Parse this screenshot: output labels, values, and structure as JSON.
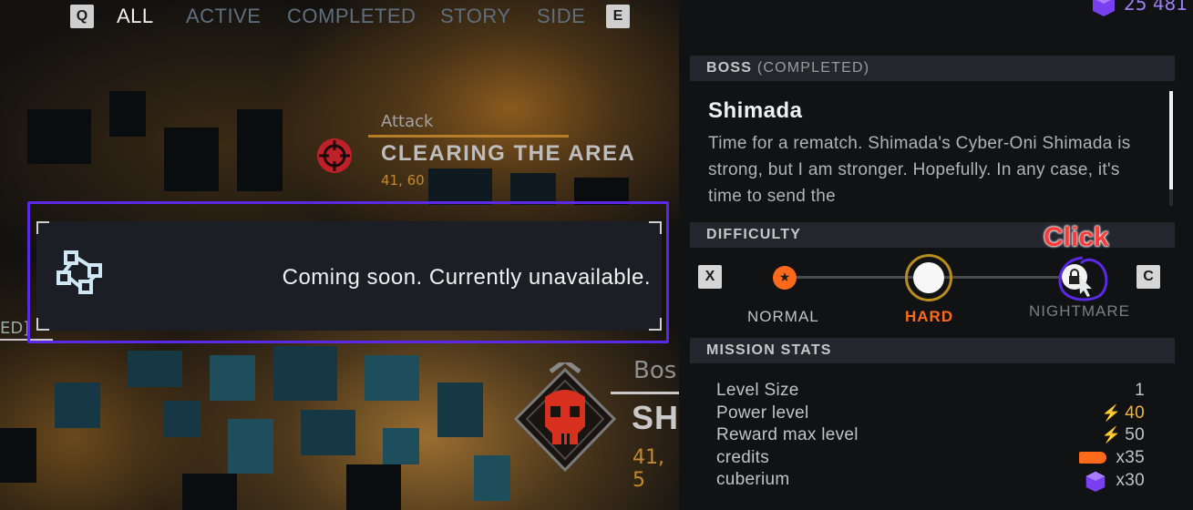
{
  "top_tabs": {
    "prev_key": "Q",
    "next_key": "E",
    "items": [
      {
        "label": "ALL",
        "active": true
      },
      {
        "label": "ACTIVE",
        "active": false
      },
      {
        "label": "COMPLETED",
        "active": false
      },
      {
        "label": "STORY",
        "active": false
      },
      {
        "label": "SIDE",
        "active": false
      }
    ]
  },
  "map": {
    "attack_marker": {
      "type": "Attack",
      "title": "CLEARING THE AREA",
      "coords": "41, 60",
      "icon": "crosshair-icon"
    },
    "boss_marker": {
      "type": "Bos",
      "title": "SH",
      "coords": "41, 5",
      "icon": "skull-icon"
    },
    "edge_fragment": "ED]"
  },
  "tooltip": {
    "icon": "network-nodes-icon",
    "message": "Coming soon. Currently unavailable."
  },
  "panel": {
    "currency": {
      "icon": "cuberium-icon",
      "value": "25 481"
    },
    "mission_header": {
      "label": "BOSS",
      "status": "(COMPLETED)"
    },
    "mission_name": "Shimada",
    "mission_description": "Time for a rematch. Shimada's Cyber-Oni Shimada is strong, but I am stronger. Hopefully. In any case, it's time to send the",
    "difficulty_header": "DIFFICULTY",
    "difficulty": {
      "prev_key": "X",
      "next_key": "C",
      "levels": [
        {
          "label": "NORMAL",
          "state": "completed",
          "icon": "star-icon"
        },
        {
          "label": "HARD",
          "state": "selected"
        },
        {
          "label": "NIGHTMARE",
          "state": "locked",
          "icon": "lock-icon"
        }
      ]
    },
    "annotation_label": "Click",
    "stats_header": "MISSION STATS",
    "stats": [
      {
        "label": "Level Size",
        "value": "1"
      },
      {
        "label": "Power level",
        "value": "40",
        "icon": "bolt-icon"
      },
      {
        "label": "Reward max level",
        "value": "50",
        "icon": "bolt-icon"
      },
      {
        "label": "credits",
        "value": "x35",
        "icon": "credits-icon"
      },
      {
        "label": "cuberium",
        "value": "x30",
        "icon": "cuberium-icon"
      }
    ]
  },
  "colors": {
    "accent_orange": "#ff6a1a",
    "highlight_purple": "#5b28e6",
    "hard_ring": "#b88d1c",
    "annotation_red": "#ff3a3a"
  }
}
